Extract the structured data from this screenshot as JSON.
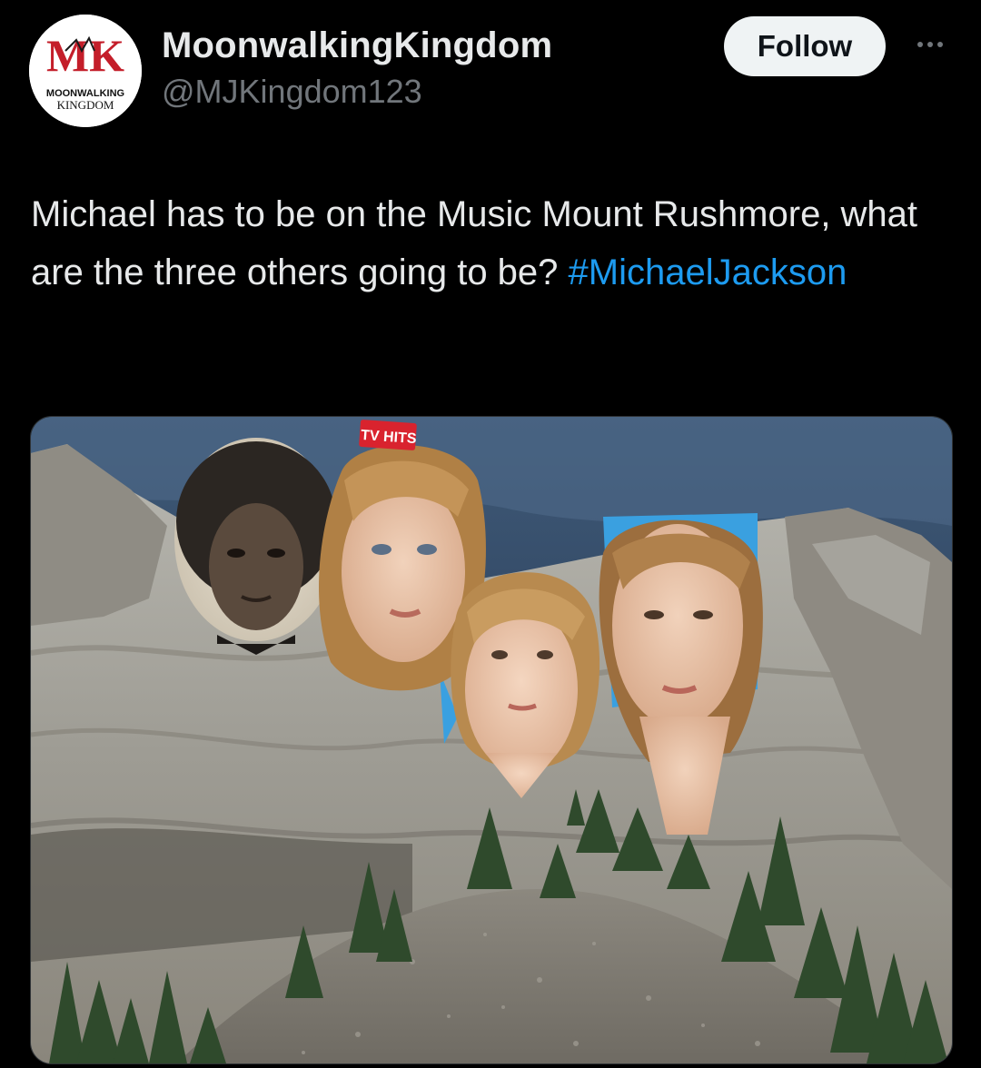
{
  "account": {
    "display_name": "MoonwalkingKingdom",
    "handle": "@MJKingdom123",
    "avatar_logo": {
      "monogram": "MK",
      "line1": "MOONWALKING",
      "line2": "KINGDOM"
    }
  },
  "actions": {
    "follow_label": "Follow",
    "more_icon": "ellipsis-horizontal-icon"
  },
  "tweet": {
    "text": "Michael has to be on the Music Mount Rushmore, what are the three others going to be?",
    "hashtag": "#MichaelJackson"
  },
  "media": {
    "description_icon": "photo",
    "magazine_label": "TV HITS"
  },
  "colors": {
    "background": "#000000",
    "text": "#e7e9ea",
    "secondary": "#71767b",
    "accent": "#1d9bf0",
    "button_bg": "#eff3f4"
  }
}
